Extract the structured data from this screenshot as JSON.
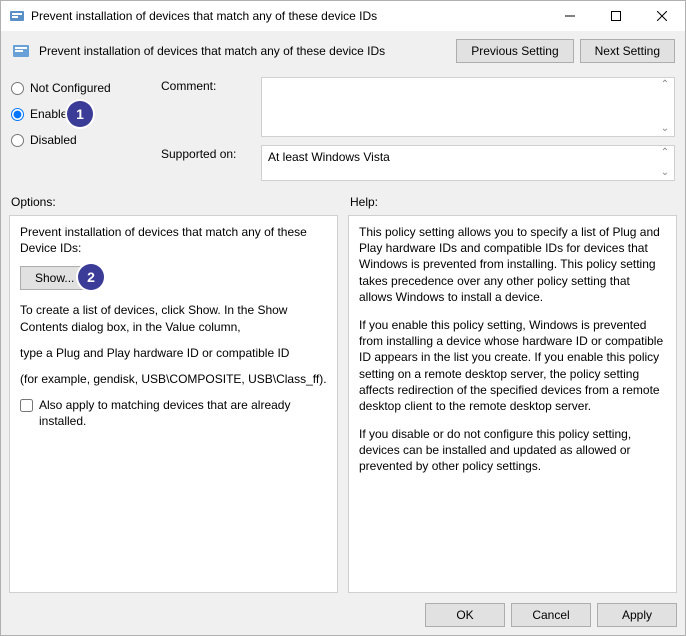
{
  "window": {
    "title": "Prevent installation of devices that match any of these device IDs"
  },
  "header": {
    "title": "Prevent installation of devices that match any of these device IDs",
    "prev_btn": "Previous Setting",
    "next_btn": "Next Setting"
  },
  "state": {
    "not_configured": "Not Configured",
    "enabled": "Enabled",
    "disabled": "Disabled",
    "selected": "enabled"
  },
  "fields": {
    "comment_label": "Comment:",
    "comment_value": "",
    "supported_label": "Supported on:",
    "supported_value": "At least Windows Vista"
  },
  "panels": {
    "options_label": "Options:",
    "help_label": "Help:"
  },
  "options": {
    "p1": "Prevent installation of devices that match any of these Device IDs:",
    "show_btn": "Show...",
    "p2": "To create a list of devices, click Show. In the Show Contents dialog box, in the Value column,",
    "p3": "type a Plug and Play hardware ID or compatible ID",
    "p4": "(for example, gendisk, USB\\COMPOSITE, USB\\Class_ff).",
    "chk_label": "Also apply to matching devices that are already installed."
  },
  "help": {
    "p1": "This policy setting allows you to specify a list of Plug and Play hardware IDs and compatible IDs for devices that Windows is prevented from installing. This policy setting takes precedence over any other policy setting that allows Windows to install a device.",
    "p2": "If you enable this policy setting, Windows is prevented from installing a device whose hardware ID or compatible ID appears in the list you create. If you enable this policy setting on a remote desktop server, the policy setting affects redirection of the specified devices from a remote desktop client to the remote desktop server.",
    "p3": "If you disable or do not configure this policy setting, devices can be installed and updated as allowed or prevented by other policy settings."
  },
  "footer": {
    "ok": "OK",
    "cancel": "Cancel",
    "apply": "Apply"
  },
  "annotations": {
    "b1": "1",
    "b2": "2"
  }
}
